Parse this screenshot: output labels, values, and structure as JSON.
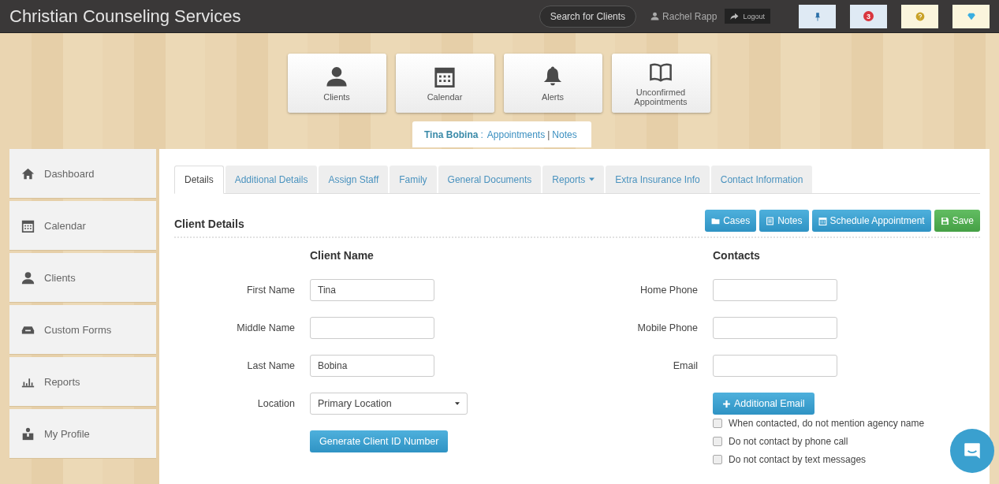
{
  "header": {
    "title": "Christian Counseling Services",
    "search_button": "Search for Clients",
    "user": "Rachel Rapp",
    "logout": "Logout",
    "notification_badge": "3"
  },
  "nav_tiles": [
    {
      "label": "Clients"
    },
    {
      "label": "Calendar"
    },
    {
      "label": "Alerts"
    },
    {
      "label": "Unconfirmed Appointments"
    }
  ],
  "client_bar": {
    "name": "Tina Bobina",
    "colon": ":",
    "links": [
      "Appointments",
      "Notes"
    ],
    "separator": "|"
  },
  "sidebar": {
    "items": [
      {
        "label": "Dashboard"
      },
      {
        "label": "Calendar"
      },
      {
        "label": "Clients"
      },
      {
        "label": "Custom Forms"
      },
      {
        "label": "Reports"
      },
      {
        "label": "My Profile"
      }
    ]
  },
  "tabs": [
    {
      "label": "Details",
      "selected": true,
      "kind": "plain"
    },
    {
      "label": "Additional Details",
      "selected": false,
      "kind": "plain"
    },
    {
      "label": "Assign Staff",
      "selected": false,
      "kind": "plain"
    },
    {
      "label": "Family",
      "selected": false,
      "kind": "plain"
    },
    {
      "label": "General Documents",
      "selected": false,
      "kind": "plain"
    },
    {
      "label": "Reports",
      "selected": false,
      "kind": "dropdown"
    },
    {
      "label": "Extra Insurance Info",
      "selected": false,
      "kind": "plain"
    },
    {
      "label": "Contact Information",
      "selected": false,
      "kind": "plain"
    }
  ],
  "section": {
    "title": "Client Details",
    "actions": [
      {
        "label": "Cases",
        "kind": "info"
      },
      {
        "label": "Notes",
        "kind": "info"
      },
      {
        "label": "Schedule Appointment",
        "kind": "info"
      },
      {
        "label": "Save",
        "kind": "success"
      }
    ]
  },
  "client_name": {
    "heading": "Client Name",
    "fields": [
      {
        "kind": "text",
        "label": "First Name",
        "value": "Tina"
      },
      {
        "kind": "text",
        "label": "Middle Name"
      },
      {
        "kind": "text",
        "label": "Last Name",
        "value": "Bobina"
      },
      {
        "kind": "select",
        "label": "Location",
        "value": "Primary Location"
      }
    ],
    "button": "Generate Client ID Number"
  },
  "contacts": {
    "heading": "Contacts",
    "fields": [
      {
        "kind": "text",
        "label": "Home Phone"
      },
      {
        "kind": "text",
        "label": "Mobile Phone"
      },
      {
        "kind": "text",
        "label": "Email"
      }
    ],
    "button": "Additional Email",
    "checkboxes": [
      {
        "label": "When contacted, do not mention agency name",
        "checked": false
      },
      {
        "label": "Do not contact by phone call",
        "checked": false
      },
      {
        "label": "Do not contact by text messages",
        "checked": false
      }
    ]
  }
}
